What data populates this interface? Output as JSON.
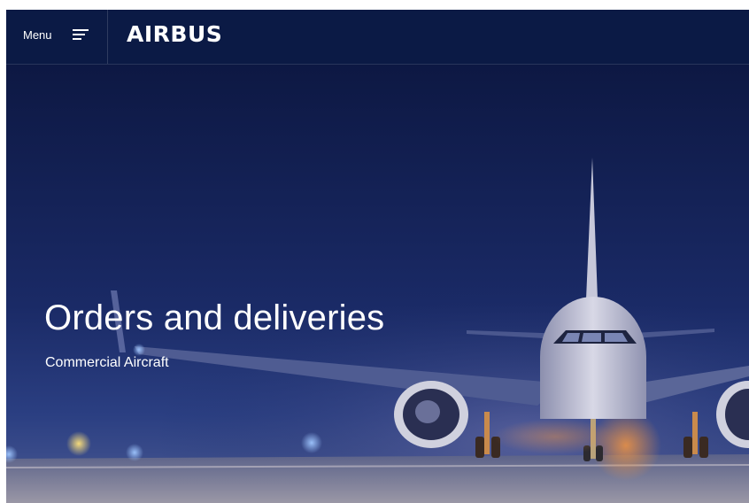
{
  "header": {
    "menu_label": "Menu",
    "menu_icon": "hamburger-menu-icon",
    "logo_text": "AIRBUS"
  },
  "hero": {
    "title": "Orders and deliveries",
    "subtitle": "Commercial Aircraft",
    "image": "aircraft-on-runway-at-night"
  },
  "colors": {
    "header_bg": "#0b1a45",
    "sky_top": "#0e1a45",
    "text": "#ffffff"
  }
}
